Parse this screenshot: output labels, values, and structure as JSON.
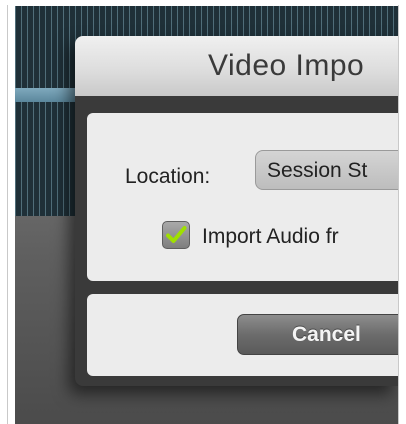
{
  "dialog": {
    "title": "Video Impo",
    "location_label": "Location:",
    "location_value": "Session St",
    "import_audio": {
      "checked": true,
      "label": "Import Audio fr"
    },
    "cancel_label": "Cancel"
  },
  "colors": {
    "timeline_bg": "#1f3038",
    "track_highlight": "#6f9db2",
    "checkmark": "#9fe000",
    "button_bg": "#6c6c6c"
  },
  "icons": {
    "checkbox": "checkmark-icon"
  }
}
